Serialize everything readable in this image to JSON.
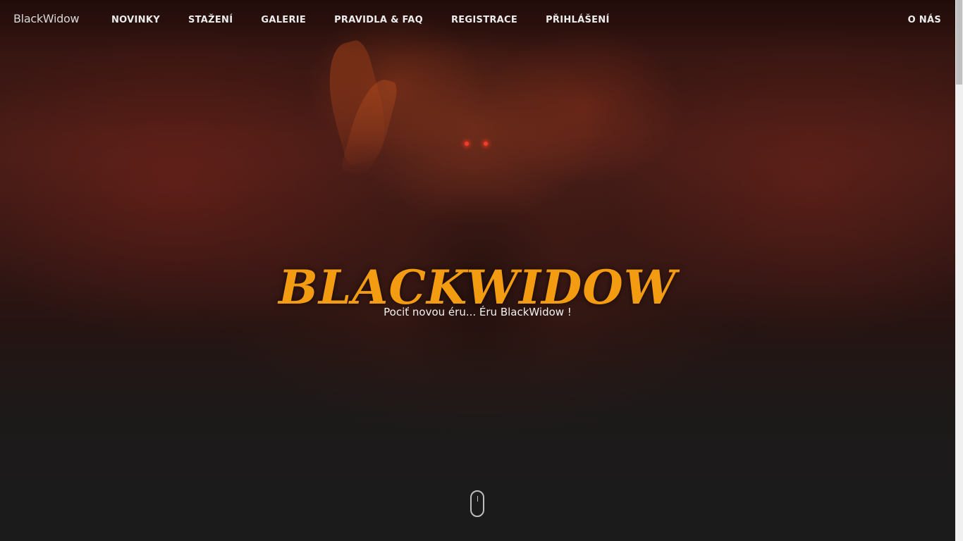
{
  "navbar": {
    "brand": "BlackWidow",
    "links": [
      {
        "label": "NOVINKY"
      },
      {
        "label": "STAŽENÍ"
      },
      {
        "label": "GALERIE"
      },
      {
        "label": "PRAVIDLA & FAQ"
      },
      {
        "label": "REGISTRACE"
      },
      {
        "label": "PŘIHLÁŠENÍ"
      }
    ],
    "right_link": "O NÁS"
  },
  "hero": {
    "title": "BLACKWIDOW",
    "subtitle": "Pociť novou éru... Éru BlackWidow !",
    "scroll_icon": "mouse-scroll-icon"
  },
  "colors": {
    "accent": "#f39c12",
    "background": "#1c1b1b",
    "nav_text": "#ececec"
  }
}
